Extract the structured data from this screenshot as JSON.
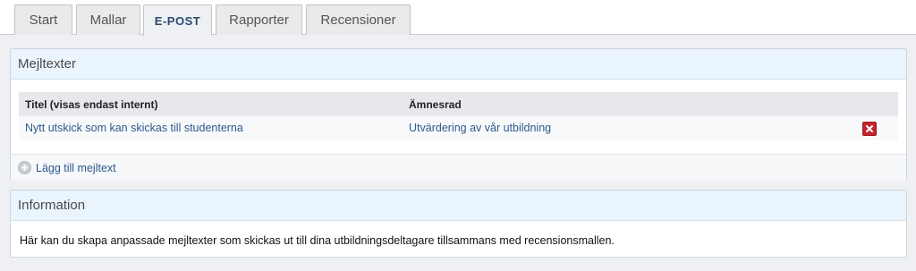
{
  "tabs": [
    {
      "label": "Start"
    },
    {
      "label": "Mallar"
    },
    {
      "label": "E-POST"
    },
    {
      "label": "Rapporter"
    },
    {
      "label": "Recensioner"
    }
  ],
  "active_tab": "E-POST",
  "mail_panel": {
    "title": "Mejltexter",
    "columns": [
      "Titel (visas endast internt)",
      "Ämnesrad"
    ],
    "rows": [
      {
        "title": "Nytt utskick som kan skickas till studenterna",
        "subject": "Utvärdering av vår utbildning"
      }
    ],
    "add_label": "Lägg till mejltext"
  },
  "info_panel": {
    "title": "Information",
    "text": "Här kan du skapa anpassade mejltexter som skickas ut till dina utbildningsdeltagare tillsammans med recensionsmallen."
  },
  "colors": {
    "link": "#2c5a8c",
    "active_tab_text": "#2b4a6f",
    "panel_header_bg": "#eaf4fc",
    "delete_red": "#c4252c"
  },
  "icons": {
    "delete": "close-icon",
    "add": "plus-circle-icon"
  }
}
